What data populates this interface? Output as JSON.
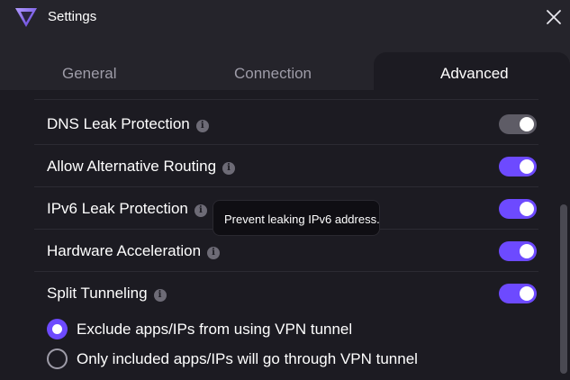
{
  "window": {
    "title": "Settings",
    "logo_icon": "protonvpn-logo-icon",
    "close_icon": "close-icon"
  },
  "tabs": [
    {
      "label": "General",
      "active": false
    },
    {
      "label": "Connection",
      "active": false
    },
    {
      "label": "Advanced",
      "active": true
    }
  ],
  "settings": [
    {
      "label": "DNS Leak Protection",
      "enabled": false
    },
    {
      "label": "Allow Alternative Routing",
      "enabled": true
    },
    {
      "label": "IPv6 Leak Protection",
      "enabled": true
    },
    {
      "label": "Hardware Acceleration",
      "enabled": true
    },
    {
      "label": "Split Tunneling",
      "enabled": true
    }
  ],
  "split_tunneling_modes": [
    {
      "label": "Exclude apps/IPs from using VPN tunnel",
      "selected": true
    },
    {
      "label": "Only included apps/IPs will go through VPN tunnel",
      "selected": false
    }
  ],
  "tooltip": {
    "text": "Prevent leaking IPv6 address."
  },
  "colors": {
    "accent": "#6d4aff",
    "background": "#1c1b22",
    "titlebar": "#25242b",
    "toggle_off": "#5e5c66"
  }
}
